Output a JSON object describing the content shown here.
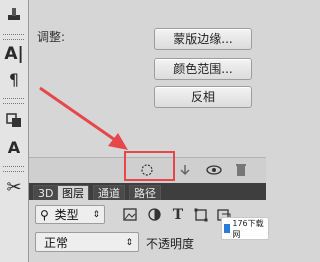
{
  "properties": {
    "adjust_label": "调整:",
    "buttons": [
      "蒙版边缘...",
      "颜色范围...",
      "反相"
    ]
  },
  "tabs": [
    "3D",
    "图层",
    "通道",
    "路径"
  ],
  "tab_active": "图层",
  "layers": {
    "kind_label": "类型",
    "blend_mode": "正常",
    "opacity_label": "不透明度"
  },
  "watermark": "176下载网",
  "icons": {
    "toolbar": [
      "brush-icon",
      "text-icon",
      "paragraph-icon",
      "clone-source-icon",
      "character-style-icon",
      "scissors-icon"
    ],
    "footer": [
      "load-selection-icon",
      "apply-mask-icon",
      "visibility-icon",
      "delete-icon"
    ],
    "filters": [
      "image-filter-icon",
      "adjustment-filter-icon",
      "type-filter-icon",
      "shape-filter-icon",
      "smart-object-filter-icon"
    ]
  },
  "colors": {
    "highlight": "#e5474b",
    "arrow": "#e5474b"
  }
}
